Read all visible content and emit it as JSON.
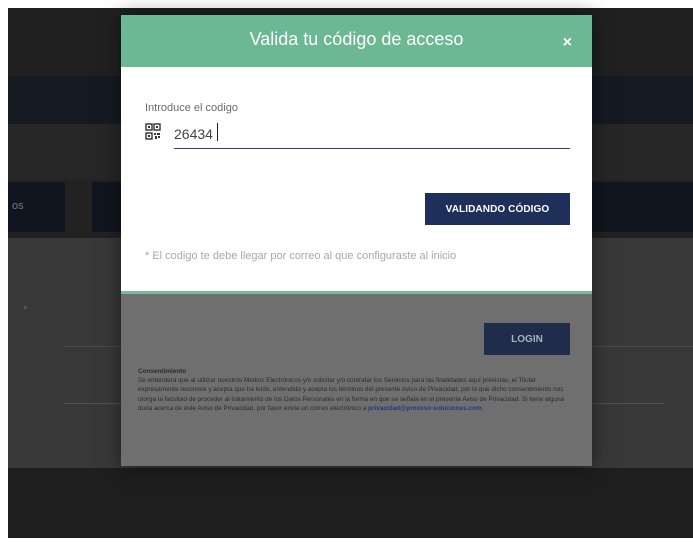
{
  "background": {
    "left_tab_label": "os"
  },
  "modal": {
    "title": "Valida tu código de acceso",
    "close_label": "×",
    "input_label": "Introduce el codigo",
    "code_value": "26434",
    "validate_button": "VALIDANDO CÓDIGO",
    "hint": "* El codigo te debe llegar por correo al que configuraste al inicio"
  },
  "login": {
    "button": "LOGIN",
    "consent_title": "Consentimiento",
    "consent_text": "Se entenderá que al utilizar nuestros Medios Electrónicos y/o solicitar y/o contratar los Servicios para las finalidades aquí previstas, el Titular expresamente reconoce y acepta que ha leído, entendido y acepta los términos del presente Aviso de Privacidad, por lo que dicho consentimiento nos otorga la facultad de proceder al tratamiento de los Datos Personales en la forma en que se señala en el presente Aviso de Privacidad. Si tiene alguna duda acerca de este Aviso de Privacidad, por favor envíe un correo electrónico a ",
    "consent_email": "privacidad@proceso-soluciones.com",
    "consent_end": "."
  },
  "colors": {
    "header_green": "#6cb893",
    "button_navy": "#1e2f5a"
  }
}
